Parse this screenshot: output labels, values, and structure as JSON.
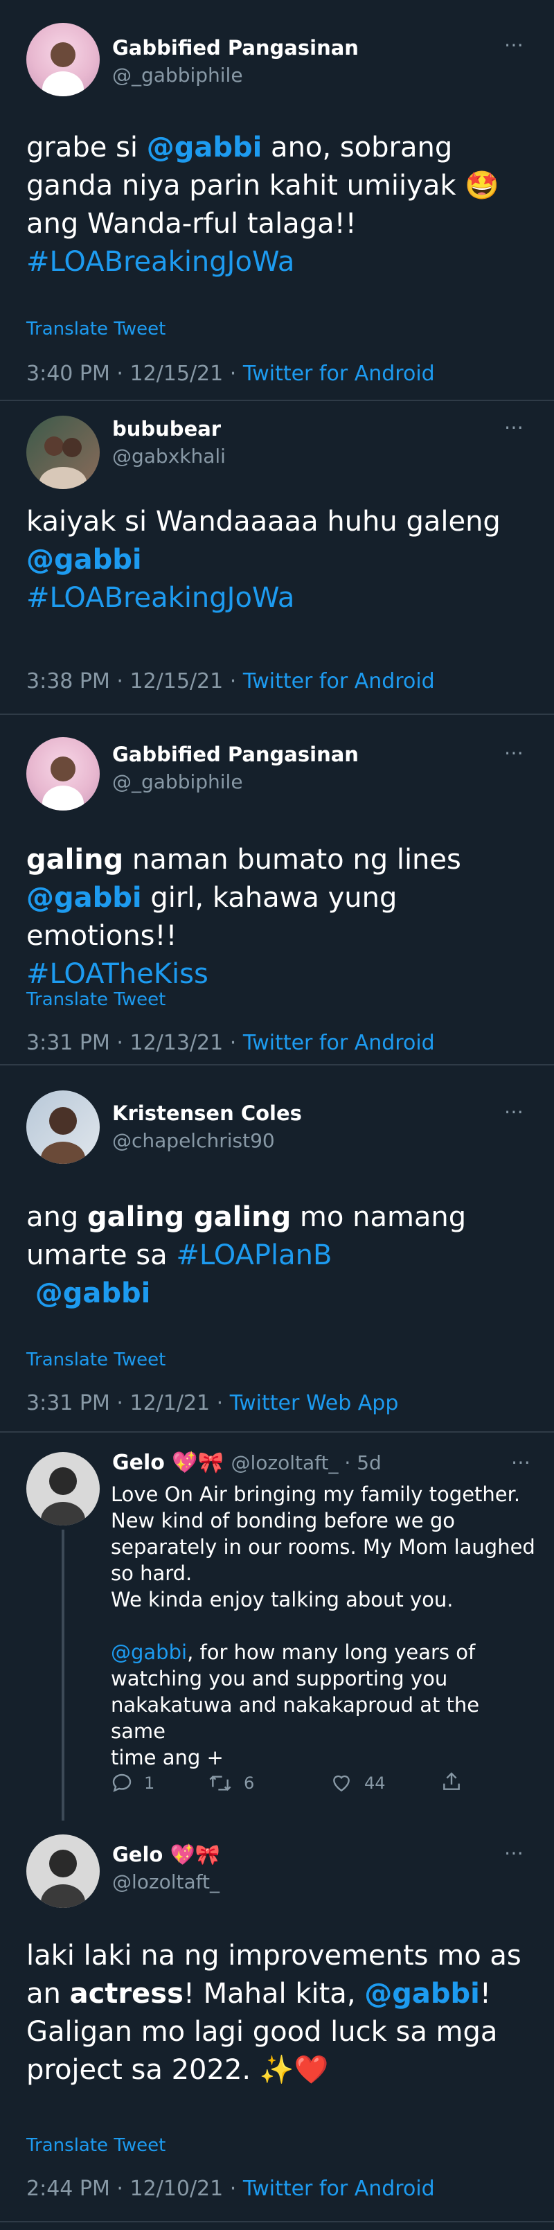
{
  "tweets": [
    {
      "name": "Gabbified Pangasinan",
      "handle": "@_gabbiphile",
      "body": [
        "grabe si ",
        "@gabbi",
        " ano, sobrang ganda niya parin kahit umiiyak ",
        "🤩",
        " ang Wanda-rful talaga!! ",
        "#LOABreakingJoWa"
      ],
      "translate": "Translate Tweet",
      "time": "3:40 PM · 12/15/21 · ",
      "app": "Twitter for Android"
    },
    {
      "name": "bububear",
      "handle": "@gabxkhali",
      "body": [
        "kaiyak si Wandaaaaa huhu galeng ",
        "@gabbi",
        " ",
        "#LOABreakingJoWa"
      ],
      "time": "3:38 PM · 12/15/21 · ",
      "app": "Twitter for Android"
    },
    {
      "name": "Gabbified Pangasinan",
      "handle": "@_gabbiphile",
      "body": [
        "galing",
        " naman bumato ng lines ",
        "@gabbi",
        " girl, kahawa yung emotions!! ",
        "#LOATheKiss"
      ],
      "translate": "Translate Tweet",
      "time": "3:31 PM · 12/13/21 · ",
      "app": "Twitter for Android"
    },
    {
      "name": "Kristensen Coles",
      "handle": "@chapelchrist90",
      "body": [
        "ang ",
        "galing galing",
        " mo namang umarte sa ",
        "#LOAPlanB",
        "@gabbi"
      ],
      "translate": "Translate Tweet",
      "time": "3:31 PM · 12/1/21 · ",
      "app": "Twitter Web App"
    },
    {
      "name": "Gelo",
      "emoji": "💖🎀",
      "handle": "@lozoltaft_",
      "age": " · 5d",
      "body_lines": [
        "Love On Air bringing my family together.",
        "New kind of bonding before we go",
        "separately in our rooms. My Mom laughed",
        "so hard.",
        "We kinda enjoy talking about you."
      ],
      "body_mention": "@gabbi",
      "body_rest": [
        ", for how many long years of",
        "watching you and supporting you",
        "nakakatuwa and nakakaproud at the same",
        "time ang +"
      ],
      "replies": "1",
      "retweets": "6",
      "likes": "44"
    },
    {
      "name": "Gelo",
      "emoji": "💖🎀",
      "handle": "@lozoltaft_",
      "body": [
        "laki laki na ng improvements mo as an ",
        "actress",
        "! Mahal kita, ",
        "@gabbi",
        "! Galigan mo lagi good luck sa mga project sa 2022. ",
        "✨❤️"
      ],
      "translate": "Translate Tweet",
      "time": "2:44 PM · 12/10/21 · ",
      "app": "Twitter for Android"
    }
  ],
  "more_icon": "⋯",
  "colors": {
    "background": "#15202b",
    "accent": "#1d9bf0",
    "muted": "#8899a6"
  }
}
